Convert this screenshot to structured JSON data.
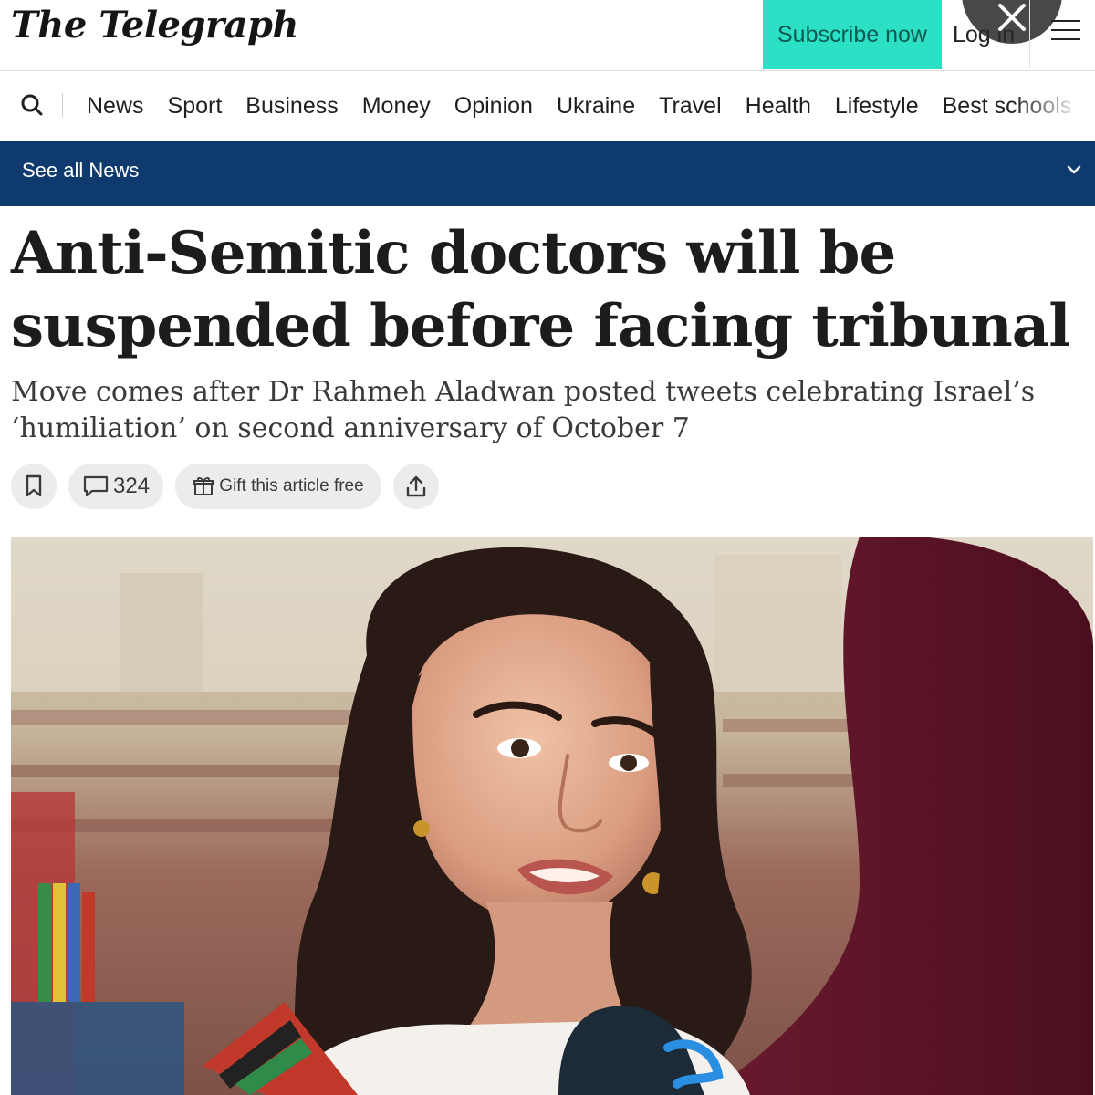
{
  "header": {
    "logo": "The Telegraph",
    "subscribe_label": "Subscribe now",
    "login_label": "Log in",
    "colors": {
      "subscribe_bg": "#2ce0c6",
      "nav_bar": "#0e3a6e"
    },
    "icons": [
      "close-icon",
      "hamburger-menu-icon",
      "search-icon"
    ]
  },
  "nav": {
    "items": [
      "News",
      "Sport",
      "Business",
      "Money",
      "Opinion",
      "Ukraine",
      "Travel",
      "Health",
      "Lifestyle",
      "Best schools"
    ]
  },
  "section_bar": {
    "label": "See all News"
  },
  "article": {
    "headline": "Anti-Semitic doctors will be suspended before facing tribunal",
    "standfirst": "Move comes after Dr Rahmeh Aladwan posted tweets celebrating Israel’s ‘humiliation’ on second anniversary of October 7",
    "comment_count": "324",
    "gift_label": "Gift this article free"
  }
}
